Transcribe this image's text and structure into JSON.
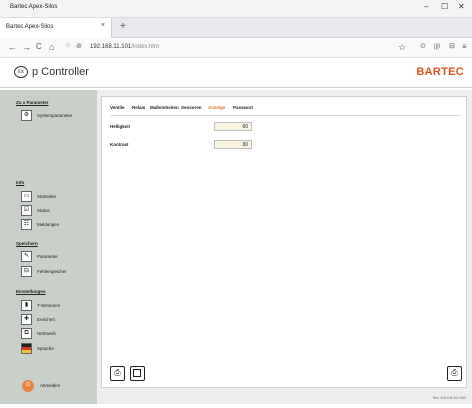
{
  "browser": {
    "window_title": "Bartec Apex-Silos",
    "controls": {
      "minimize": "–",
      "maximize": "☐",
      "close": "✕"
    },
    "tab_label": "Bartec Apex-Silos",
    "tab_close": "×",
    "new_tab": "+",
    "nav": {
      "back": "←",
      "forward": "→",
      "reload": "C",
      "home": "⌂"
    },
    "url_host": "192.168.11.101",
    "url_path": "/index.htm",
    "star": "☆",
    "right_icons": {
      "pocket": "⊙",
      "library": "|||\\",
      "sidebar": "⊟",
      "menu": "≡"
    }
  },
  "header": {
    "ex_mark": "εx",
    "title": "p Controller",
    "brand": "BARTEC"
  },
  "sidebar": {
    "sections": [
      {
        "heading": "Zu x Parameter",
        "items": [
          {
            "label": "Systemparameter",
            "icon": "settings-icon",
            "glyph": "⚙"
          }
        ]
      },
      {
        "heading": "Info",
        "items": [
          {
            "label": "Startseite",
            "icon": "home-icon",
            "glyph": "▭"
          },
          {
            "label": "Status",
            "icon": "status-icon",
            "glyph": "☑"
          },
          {
            "label": "Meldungen",
            "icon": "messages-icon",
            "glyph": "☷"
          }
        ]
      },
      {
        "heading": "Speichern",
        "items": [
          {
            "label": "Parameter",
            "icon": "parameter-icon",
            "glyph": "✎"
          },
          {
            "label": "Fehlerspeicher",
            "icon": "error-memory-icon",
            "glyph": "⊟"
          }
        ]
      },
      {
        "heading": "Einstellungen",
        "items": [
          {
            "label": "T-Sensoren",
            "icon": "sensor-icon",
            "glyph": "▮"
          },
          {
            "label": "Ereichert",
            "icon": "plus-icon",
            "glyph": "✚"
          },
          {
            "label": "Netzwerk",
            "icon": "network-icon",
            "glyph": "⧉"
          },
          {
            "label": "Sprache",
            "icon": "language-flag-icon",
            "glyph": ""
          }
        ]
      }
    ],
    "logout": {
      "label": "Abmelden",
      "icon": "power-icon",
      "glyph": "⏻"
    }
  },
  "content": {
    "tabs": [
      "Ventile",
      "Relais",
      "Maßeinheiten",
      "Sensoren",
      "Anzeige",
      "Passwort"
    ],
    "active_tab": "Anzeige",
    "fields": [
      {
        "label": "Helligkeit",
        "value": "60"
      },
      {
        "label": "Kontrast",
        "value": "30"
      }
    ],
    "bottom_left_buttons": [
      {
        "name": "save-action-icon",
        "glyph": "⎙"
      },
      {
        "name": "window-icon",
        "glyph": ""
      }
    ],
    "bottom_right_button": {
      "name": "save-action-icon",
      "glyph": "⎙"
    }
  },
  "footer": "Rev 415 A.B.001.000",
  "colors": {
    "accent": "#e36b25",
    "brand": "#d9531e",
    "sidebar_bg": "#c9cfc9"
  }
}
